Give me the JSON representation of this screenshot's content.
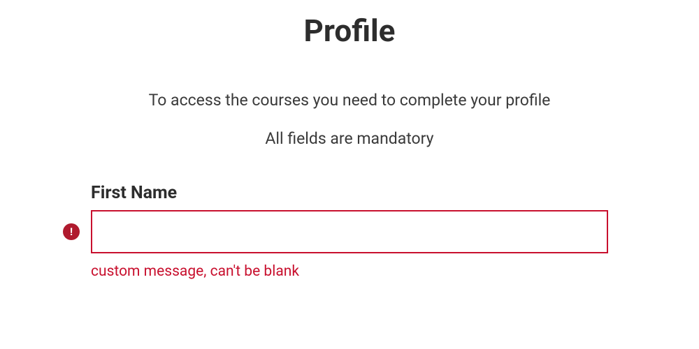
{
  "header": {
    "title": "Profile"
  },
  "instructions": {
    "line1": "To access the courses you need to complete your profile",
    "line2": "All fields are mandatory"
  },
  "form": {
    "firstName": {
      "label": "First Name",
      "value": "",
      "error": "custom message, can't be blank",
      "errorIconGlyph": "!"
    }
  },
  "colors": {
    "error": "#c8102e",
    "errorIconBg": "#b01a2e",
    "text": "#2d2d2d"
  }
}
